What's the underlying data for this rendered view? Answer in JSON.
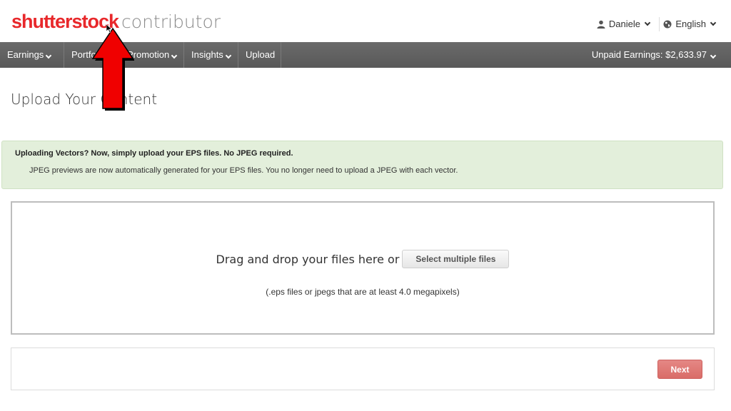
{
  "header": {
    "logo_brand": "shutterstock",
    "logo_sub": "contributor",
    "user_name": "Daniele",
    "language": "English",
    "icons": {
      "user": "user-icon",
      "globe": "globe-icon"
    }
  },
  "nav": {
    "items": [
      {
        "label": "Earnings",
        "dropdown": true
      },
      {
        "label": "Portfolio",
        "dropdown": false
      },
      {
        "label": "Promotion",
        "dropdown": true
      },
      {
        "label": "Insights",
        "dropdown": true
      },
      {
        "label": "Upload",
        "dropdown": false
      }
    ],
    "unpaid_label": "Unpaid Earnings: $2,633.97"
  },
  "page": {
    "title": "Upload Your Content"
  },
  "alert": {
    "title": "Uploading Vectors? Now, simply upload your EPS files. No JPEG required.",
    "body": "JPEG previews are now automatically generated for your EPS files. You no longer need to upload a JPEG with each vector."
  },
  "dropzone": {
    "text": "Drag and drop your files here or",
    "button_label": "Select multiple files",
    "hint": "(.eps files or jpegs that are at least 4.0 megapixels)"
  },
  "footer": {
    "next_label": "Next"
  },
  "colors": {
    "brand_red": "#e8282b",
    "nav_bg": "#5f5f5f",
    "alert_bg": "#e3efdb",
    "next_button": "#d65d58",
    "annotation_arrow": "#ff0000"
  }
}
